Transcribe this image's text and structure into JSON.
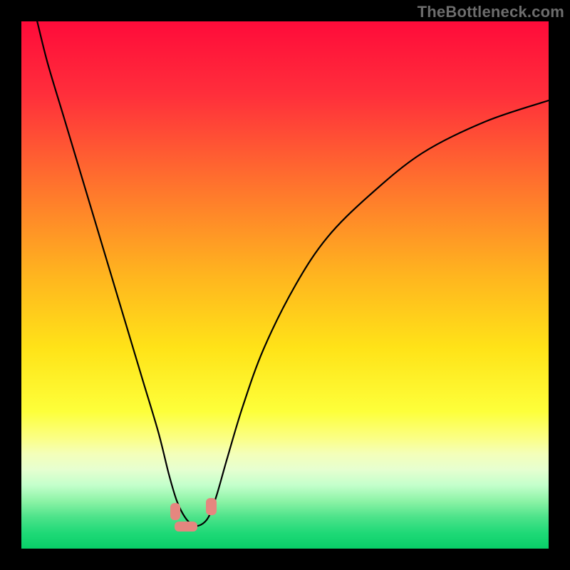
{
  "watermark": "TheBottleneck.com",
  "chart_data": {
    "type": "line",
    "title": "",
    "xlabel": "",
    "ylabel": "",
    "xlim": [
      0,
      100
    ],
    "ylim": [
      0,
      100
    ],
    "grid": false,
    "legend": false,
    "series": [
      {
        "name": "bottleneck-curve",
        "x": [
          3,
          5,
          8,
          11,
          14,
          17,
          20,
          23,
          26,
          28,
          29.5,
          31,
          32.5,
          34,
          35.5,
          37,
          39,
          42,
          46,
          52,
          58,
          66,
          76,
          88,
          100
        ],
        "y": [
          100,
          92,
          82,
          72,
          62,
          52,
          42,
          32,
          22,
          14,
          9,
          6,
          4.5,
          4.5,
          6,
          10,
          17,
          27,
          38,
          50,
          59,
          67,
          75,
          81,
          85
        ]
      }
    ],
    "annotations": [
      {
        "name": "marker-left",
        "x": 29.2,
        "y": 7.0,
        "w": 2.0,
        "h": 3.2
      },
      {
        "name": "marker-floor",
        "x": 31.2,
        "y": 4.2,
        "w": 4.3,
        "h": 2.0
      },
      {
        "name": "marker-right",
        "x": 36.0,
        "y": 8.0,
        "w": 2.0,
        "h": 3.2
      }
    ],
    "background_gradient_stops": [
      {
        "pct": 0,
        "color": "#ff0b3a"
      },
      {
        "pct": 14,
        "color": "#ff2f3b"
      },
      {
        "pct": 30,
        "color": "#ff6f2e"
      },
      {
        "pct": 48,
        "color": "#ffb41f"
      },
      {
        "pct": 62,
        "color": "#ffe318"
      },
      {
        "pct": 74,
        "color": "#fdff3a"
      },
      {
        "pct": 79,
        "color": "#fbff84"
      },
      {
        "pct": 82,
        "color": "#f4ffb9"
      },
      {
        "pct": 85,
        "color": "#e6ffd0"
      },
      {
        "pct": 88,
        "color": "#c3ffcb"
      },
      {
        "pct": 91,
        "color": "#8cf3a6"
      },
      {
        "pct": 94,
        "color": "#4de38a"
      },
      {
        "pct": 97,
        "color": "#1fd977"
      },
      {
        "pct": 100,
        "color": "#09cf68"
      }
    ]
  }
}
